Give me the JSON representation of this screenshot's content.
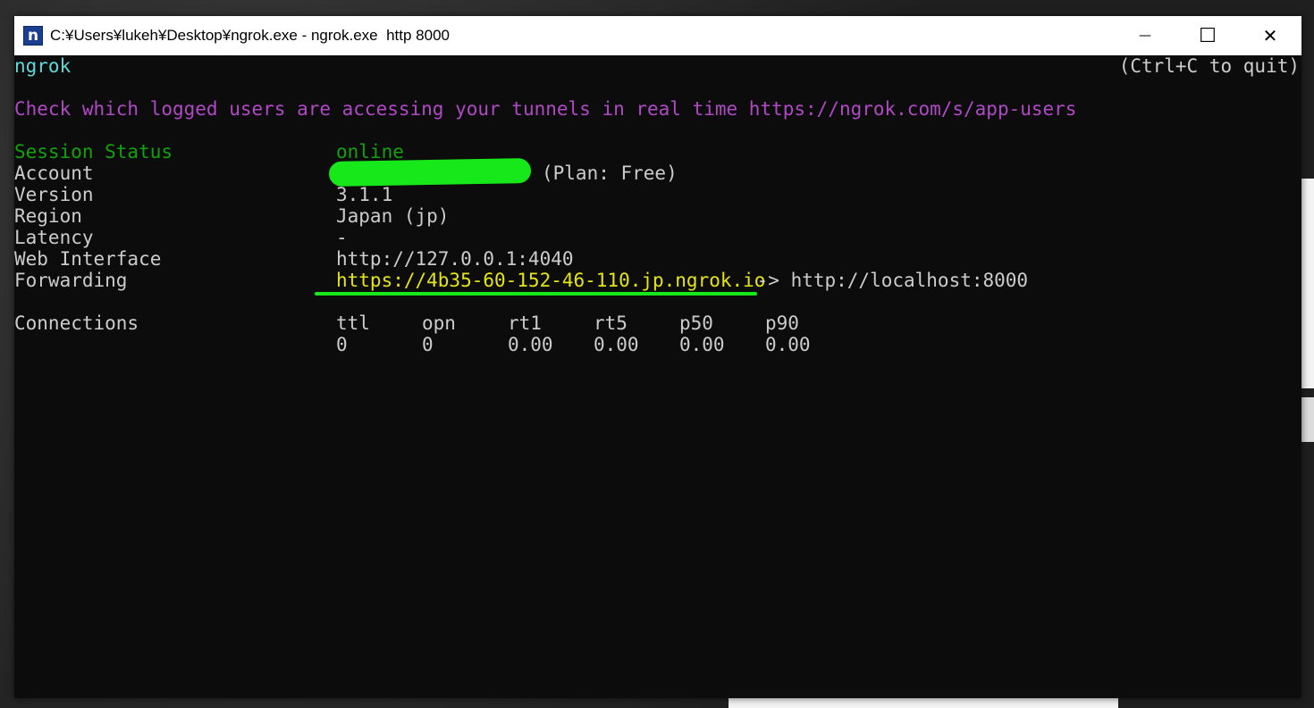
{
  "window": {
    "title": "C:¥Users¥lukeh¥Desktop¥ngrok.exe - ngrok.exe  http 8000",
    "app_icon_letter": "n",
    "minimize_glyph": "—",
    "maximize_glyph": "☐",
    "close_glyph": "✕"
  },
  "terminal": {
    "app_name": "ngrok",
    "quit_hint": "(Ctrl+C to quit)",
    "banner": "Check which logged users are accessing your tunnels in real time https://ngrok.com/s/app-users",
    "fields": [
      {
        "label": "Session Status",
        "value": "online"
      },
      {
        "label": "Account",
        "value": "(Plan: Free)"
      },
      {
        "label": "Version",
        "value": "3.1.1"
      },
      {
        "label": "Region",
        "value": "Japan (jp)"
      },
      {
        "label": "Latency",
        "value": "-"
      },
      {
        "label": "Web Interface",
        "value": "http://127.0.0.1:4040"
      },
      {
        "label": "Forwarding",
        "value_url": "https://4b35-60-152-46-110.jp.ngrok.io",
        "value_arrow": " -> http://localhost:8000"
      }
    ],
    "connections": {
      "label": "Connections",
      "headers": [
        "ttl",
        "opn",
        "rt1",
        "rt5",
        "p50",
        "p90"
      ],
      "values": [
        "0",
        "0",
        "0.00",
        "0.00",
        "0.00",
        "0.00"
      ]
    }
  },
  "colors": {
    "terminal_bg": "#0c0c0c",
    "cyan": "#61d6d6",
    "magenta": "#b148c6",
    "green": "#13a10e",
    "yellow": "#e5e510",
    "highlighter": "#17e81a"
  }
}
